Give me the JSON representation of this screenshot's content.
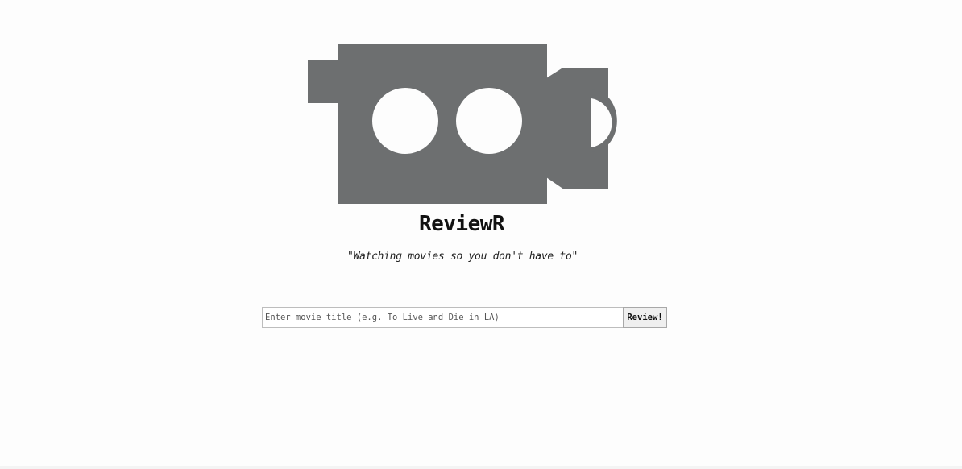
{
  "app": {
    "title": "ReviewR",
    "tagline": "\"Watching movies so you don't have to\""
  },
  "logo": {
    "icon": "movie-camera-icon",
    "color": "#6d6f70"
  },
  "search": {
    "placeholder": "Enter movie title (e.g. To Live and Die in LA)",
    "value": "",
    "button_label": "Review!"
  }
}
